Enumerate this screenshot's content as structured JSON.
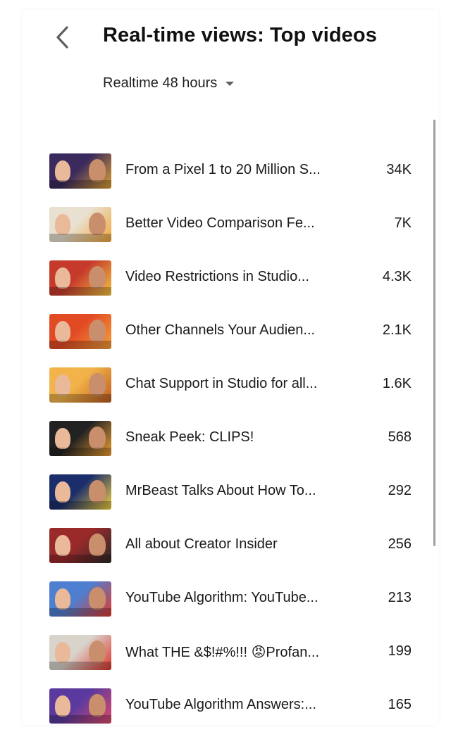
{
  "header": {
    "title": "Real-time views: Top videos",
    "back_icon": "chevron-left-icon"
  },
  "filter": {
    "range_label": "Realtime 48 hours",
    "dropdown_icon": "caret-down-icon"
  },
  "videos": [
    {
      "title": "From a Pixel 1 to 20 Million S...",
      "views": "34K",
      "thumb_colors": [
        "#3a2a5e",
        "#e0a030"
      ]
    },
    {
      "title": "Better Video Comparison Fe...",
      "views": "7K",
      "thumb_colors": [
        "#e8e0d0",
        "#f2a63a"
      ]
    },
    {
      "title": "Video Restrictions in Studio...",
      "views": "4.3K",
      "thumb_colors": [
        "#c63a2c",
        "#f4c542"
      ]
    },
    {
      "title": "Other Channels Your Audien...",
      "views": "2.1K",
      "thumb_colors": [
        "#e24a24",
        "#f6a13a"
      ]
    },
    {
      "title": "Chat Support in Studio for all...",
      "views": "1.6K",
      "thumb_colors": [
        "#f2b44a",
        "#c05a20"
      ]
    },
    {
      "title": "Sneak Peek: CLIPS!",
      "views": "568",
      "thumb_colors": [
        "#222222",
        "#f0a030"
      ]
    },
    {
      "title": "MrBeast Talks About How To...",
      "views": "292",
      "thumb_colors": [
        "#1b2e6b",
        "#f4d03f"
      ]
    },
    {
      "title": "All about Creator Insider",
      "views": "256",
      "thumb_colors": [
        "#9a2a2a",
        "#2a2a2a"
      ]
    },
    {
      "title": "YouTube Algorithm: YouTube...",
      "views": "213",
      "thumb_colors": [
        "#4f7fd0",
        "#e23b2e"
      ]
    },
    {
      "title": "What THE &$!#%!!! 😡Profan...",
      "views": "199",
      "thumb_colors": [
        "#d8d4cc",
        "#e0342c"
      ]
    },
    {
      "title": "YouTube Algorithm Answers:...",
      "views": "165",
      "thumb_colors": [
        "#5a3a9e",
        "#e04a6a"
      ]
    }
  ]
}
